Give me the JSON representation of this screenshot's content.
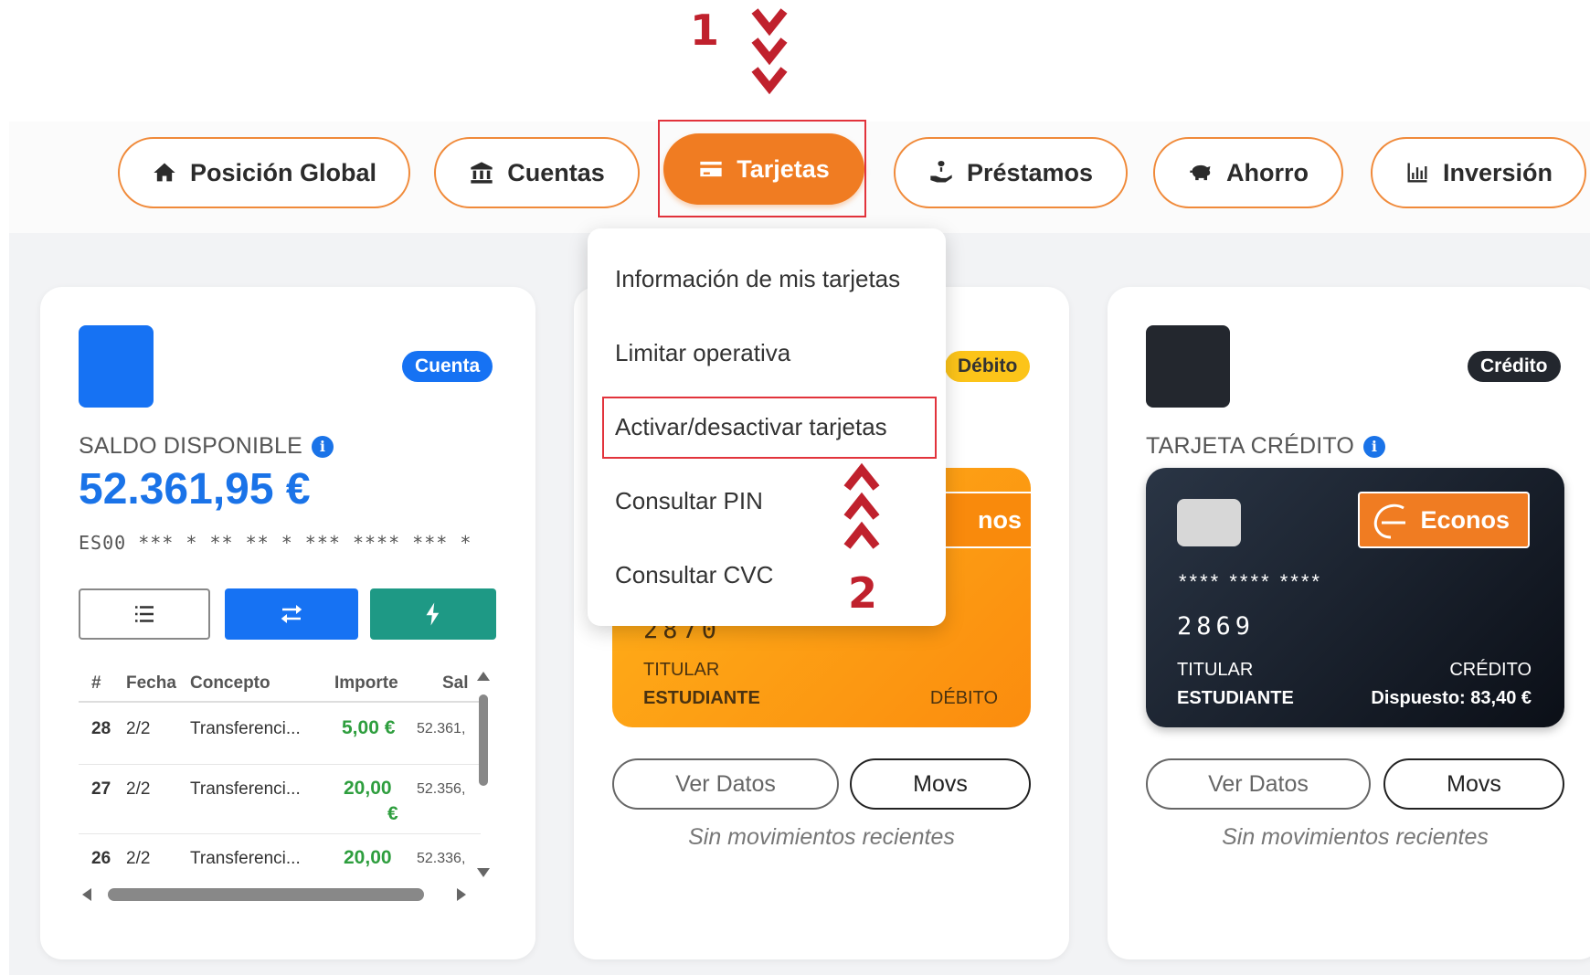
{
  "annotations": {
    "step1": "1",
    "step2": "2"
  },
  "nav": {
    "items": [
      {
        "label": "Posición Global",
        "icon": "home-icon"
      },
      {
        "label": "Cuentas",
        "icon": "bank-icon"
      },
      {
        "label": "Tarjetas",
        "icon": "credit-card-icon",
        "active": true
      },
      {
        "label": "Préstamos",
        "icon": "loan-hand-icon"
      },
      {
        "label": "Ahorro",
        "icon": "piggy-bank-icon"
      },
      {
        "label": "Inversión",
        "icon": "bar-chart-icon"
      }
    ]
  },
  "dropdown": {
    "items": [
      "Información de mis tarjetas",
      "Limitar operativa",
      "Activar/desactivar tarjetas",
      "Consultar PIN",
      "Consultar CVC"
    ],
    "highlighted_index": 2
  },
  "account": {
    "badge": "Cuenta",
    "label": "SALDO DISPONIBLE",
    "balance": "52.361,95 €",
    "iban": "ES00 *** * ** ** * *** **** *** *",
    "buttons": [
      "list-icon",
      "transfer-icon",
      "lightning-icon"
    ],
    "columns": [
      "#",
      "Fecha",
      "Concepto",
      "Importe",
      "Sal"
    ],
    "rows": [
      {
        "n": "28",
        "date": "2/2",
        "concept": "Transferenci...",
        "amount": "5,00 €",
        "amount_suffix": "",
        "balance": "52.361,"
      },
      {
        "n": "27",
        "date": "2/2",
        "concept": "Transferenci...",
        "amount": "20,00",
        "amount_suffix": "€",
        "balance": "52.356,"
      },
      {
        "n": "26",
        "date": "2/2",
        "concept": "Transferenci...",
        "amount": "20,00",
        "amount_suffix": "€",
        "balance": "52.336,"
      }
    ]
  },
  "debit": {
    "badge": "Débito",
    "logo_text": "nos",
    "digits": "2870",
    "holder_label": "TITULAR",
    "holder": "ESTUDIANTE",
    "type": "DÉBITO",
    "btn_details": "Ver Datos",
    "btn_moves": "Movs",
    "no_moves": "Sin movimientos recientes"
  },
  "credit": {
    "badge": "Crédito",
    "label": "TARJETA CRÉDITO",
    "logo_text": "Econos",
    "stars": "**** **** ****",
    "digits": "2869",
    "holder_label": "TITULAR",
    "holder": "ESTUDIANTE",
    "type": "CRÉDITO",
    "disposed": "Dispuesto: 83,40 €",
    "btn_details": "Ver Datos",
    "btn_moves": "Movs",
    "no_moves": "Sin movimientos recientes"
  },
  "colors": {
    "accent": "#f07c22",
    "primary": "#1a73e8",
    "teal": "#1e9985",
    "annotation": "#c0212d"
  }
}
